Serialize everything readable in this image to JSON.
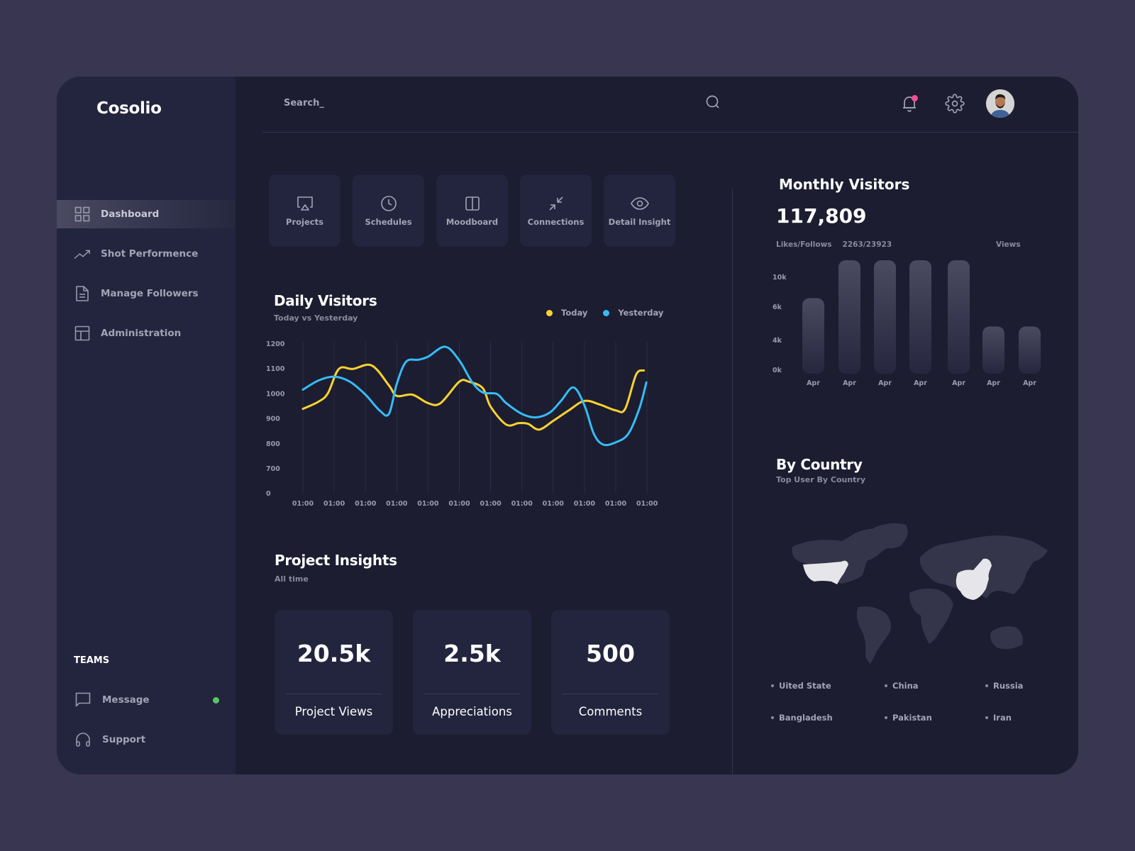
{
  "app": {
    "brand": "Cosolio"
  },
  "sidebar": {
    "items": [
      {
        "label": "Dashboard",
        "icon": "grid-icon",
        "active": true
      },
      {
        "label": "Shot Performence",
        "icon": "trending-up-icon",
        "active": false
      },
      {
        "label": "Manage Followers",
        "icon": "document-icon",
        "active": false
      },
      {
        "label": "Administration",
        "icon": "layout-icon",
        "active": false
      }
    ],
    "teams_title": "TEAMS",
    "teams": [
      {
        "label": "Message",
        "icon": "message-icon",
        "online": true
      },
      {
        "label": "Support",
        "icon": "headphones-icon",
        "online": false
      }
    ]
  },
  "header": {
    "search_placeholder": "Search_",
    "notification_badge": true,
    "colors": {
      "badge": "#f24e94"
    }
  },
  "tiles": [
    {
      "label": "Projects",
      "icon": "airplay-icon"
    },
    {
      "label": "Schedules",
      "icon": "clock-icon"
    },
    {
      "label": "Moodboard",
      "icon": "columns-icon"
    },
    {
      "label": "Connections",
      "icon": "minimize-icon"
    },
    {
      "label": "Detail Insight",
      "icon": "eye-icon"
    }
  ],
  "daily_visitors": {
    "title": "Daily Visitors",
    "subtitle": "Today vs Yesterday",
    "legend": [
      {
        "label": "Today",
        "color": "#fdd231"
      },
      {
        "label": "Yesterday",
        "color": "#36bcf7"
      }
    ]
  },
  "project_insights": {
    "title": "Project Insights",
    "subtitle": "All time",
    "cards": [
      {
        "value": "20.5k",
        "label": "Project Views"
      },
      {
        "value": "2.5k",
        "label": "Appreciations"
      },
      {
        "value": "500",
        "label": "Comments"
      }
    ]
  },
  "monthly_visitors": {
    "title": "Monthly Visitors",
    "total": "117,809",
    "likes_label": "Likes/Follows",
    "likes_value": "2263/23923",
    "views_label": "Views"
  },
  "by_country": {
    "title": "By Country",
    "subtitle": "Top User By Country",
    "highlighted": [
      "United States",
      "China"
    ],
    "countries": [
      "Uited State",
      "China",
      "Russia",
      "Bangladesh",
      "Pakistan",
      "Iran"
    ]
  },
  "chart_data": [
    {
      "type": "line",
      "title": "Daily Visitors",
      "subtitle": "Today vs Yesterday",
      "categories": [
        "01:00",
        "01:00",
        "01:00",
        "01:00",
        "01:00",
        "01:00",
        "01:00",
        "01:00",
        "01:00",
        "01:00",
        "01:00",
        "01:00"
      ],
      "yticks": [
        1200,
        1100,
        1000,
        900,
        800,
        700,
        0
      ],
      "ylim": [
        600,
        1200
      ],
      "grid": "vertical",
      "legend": "top-right",
      "series": [
        {
          "name": "Today",
          "color": "#fdd231",
          "points": [
            [
              0,
              937
            ],
            [
              0.5,
              966
            ],
            [
              0.8,
              1000
            ],
            [
              1.15,
              1097
            ],
            [
              1.6,
              1097
            ],
            [
              2.2,
              1111
            ],
            [
              2.75,
              1031
            ],
            [
              3.0,
              989
            ],
            [
              3.5,
              994
            ],
            [
              4.0,
              960
            ],
            [
              4.4,
              960
            ],
            [
              5.0,
              1046
            ],
            [
              5.3,
              1046
            ],
            [
              5.75,
              1020
            ],
            [
              6.0,
              946
            ],
            [
              6.5,
              874
            ],
            [
              6.9,
              880
            ],
            [
              7.2,
              877
            ],
            [
              7.55,
              854
            ],
            [
              8.0,
              889
            ],
            [
              8.5,
              931
            ],
            [
              9.0,
              969
            ],
            [
              9.5,
              954
            ],
            [
              10.0,
              931
            ],
            [
              10.3,
              937
            ],
            [
              10.65,
              1074
            ],
            [
              10.9,
              1091
            ]
          ]
        },
        {
          "name": "Yesterday",
          "color": "#36bcf7",
          "points": [
            [
              0,
              1014
            ],
            [
              0.5,
              1051
            ],
            [
              1.0,
              1066
            ],
            [
              1.5,
              1046
            ],
            [
              2.0,
              994
            ],
            [
              2.45,
              931
            ],
            [
              2.75,
              917
            ],
            [
              3.0,
              1037
            ],
            [
              3.3,
              1126
            ],
            [
              3.7,
              1134
            ],
            [
              4.0,
              1146
            ],
            [
              4.55,
              1186
            ],
            [
              5.0,
              1131
            ],
            [
              5.4,
              1046
            ],
            [
              5.75,
              1003
            ],
            [
              6.2,
              997
            ],
            [
              6.5,
              960
            ],
            [
              7.0,
              917
            ],
            [
              7.45,
              903
            ],
            [
              7.9,
              923
            ],
            [
              8.25,
              969
            ],
            [
              8.65,
              1023
            ],
            [
              9.0,
              951
            ],
            [
              9.3,
              837
            ],
            [
              9.6,
              794
            ],
            [
              10.0,
              803
            ],
            [
              10.4,
              837
            ],
            [
              10.75,
              937
            ],
            [
              10.98,
              1043
            ]
          ]
        }
      ]
    },
    {
      "type": "bar",
      "title": "Monthly Visitors",
      "categories": [
        "Apr",
        "Apr",
        "Apr",
        "Apr",
        "Apr",
        "Apr",
        "Apr"
      ],
      "values": [
        8000,
        12000,
        12000,
        12000,
        12000,
        5000,
        5000
      ],
      "yticks": [
        "10k",
        "6k",
        "4k",
        "0k"
      ],
      "ylabel": "Views"
    }
  ]
}
